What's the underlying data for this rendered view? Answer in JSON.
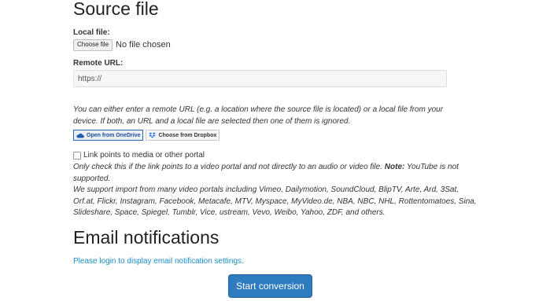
{
  "source_file": {
    "heading": "Source file",
    "local_file_label": "Local file:",
    "choose_button_label": "Choose file",
    "no_file_text": "No file chosen",
    "remote_url_label": "Remote URL:",
    "remote_url_value": "https://",
    "help_line_1": "You can either enter a remote URL (e.g. a location where the source file is located) or a local file from your",
    "help_line_2": "device. If both, an URL and a local file are selected then one of them is ignored.",
    "onedrive_label": "Open from OneDrive",
    "dropbox_label": "Choose from Dropbox",
    "media_checkbox_label": "Link points to media or other portal",
    "media_note_line_1": "Only check this if the link points to a video portal and not directly to an audio or video file.",
    "media_note_bold": "Note:",
    "media_note_tail": "YouTube is not",
    "media_note_line_2": "supported.",
    "portals_line_1": "We support import from many video portals including Vimeo, Dailymotion, SoundCloud, BlipTV, Arte, Ard, 3Sat,",
    "portals_line_2": "Orf.at, Flickr, Instagram, Facebook, Metacafe, MTV, Myspace, MyVideo.de, NBA, NBC, NHL, Rottentomatoes, Sina,",
    "portals_line_3": "Slideshare, Space, Spiegel, Tumblr, Vice, ustream, Vevo, Weibo, Yahoo, ZDF, and others."
  },
  "email": {
    "heading": "Email notifications",
    "login_link": "Please login to display email notification settings."
  },
  "actions": {
    "start_label": "Start conversion"
  },
  "icons": {
    "onedrive": "cloud-icon",
    "dropbox": "dropbox-icon"
  },
  "colors": {
    "accent": "#2f7bbf",
    "link": "#1a8cc8"
  }
}
